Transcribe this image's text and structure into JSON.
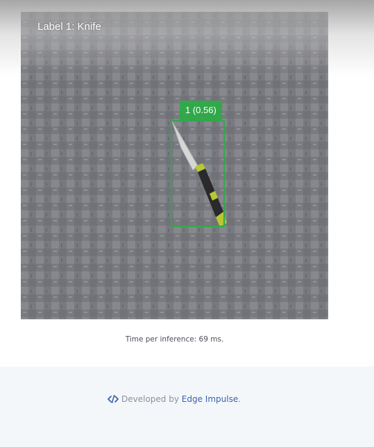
{
  "camera": {
    "overlay_label": "Label 1: Knife"
  },
  "detection": {
    "tag": "1 (0.56)",
    "label_index": 1,
    "confidence": 0.56,
    "box_color": "#31a84a"
  },
  "stats": {
    "inference_text": "Time per inference: 69 ms."
  },
  "footer": {
    "icon": "code-icon",
    "developed_by": "Developed by",
    "link_text": "Edge Impulse",
    "suffix": ".",
    "link_color": "#3a5fb0"
  }
}
